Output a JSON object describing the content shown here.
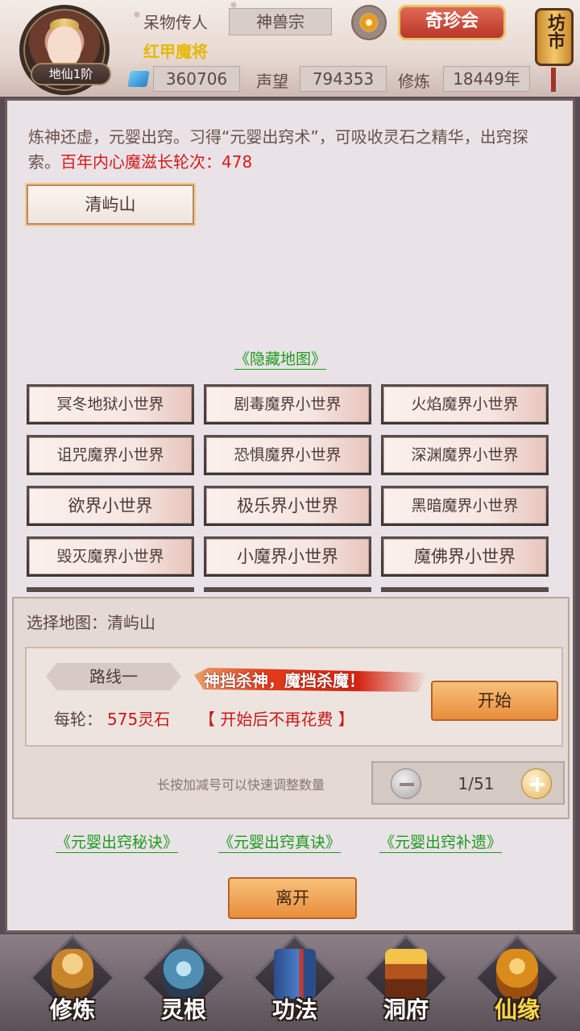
{
  "header": {
    "level_badge": "地仙1阶",
    "title_primary": "呆物传人",
    "sect": "神兽宗",
    "title_secondary": "红甲魔将",
    "treasure_button": "奇珍会",
    "market_label": "坊市",
    "gems": "360706",
    "reputation_label": "声望",
    "reputation": "794353",
    "cultivation_label": "修炼",
    "cultivation": "18449年"
  },
  "panel": {
    "description_main": "炼神还虚，元婴出窍。习得“元婴出窍术”，可吸收灵石之精华，出窍探索。",
    "description_highlight": "百年内心魔滋长轮次：478",
    "current_map": "清屿山",
    "hidden_map_link": "《隐藏地图》",
    "maps": [
      "冥冬地狱小世界",
      "剧毒魔界小世界",
      "火焰魔界小世界",
      "诅咒魔界小世界",
      "恐惧魔界小世界",
      "深渊魔界小世界",
      "欲界小世界",
      "极乐界小世界",
      "黑暗魔界小世界",
      "毁灭魔界小世界",
      "小魔界小世界",
      "魔佛界小世界"
    ],
    "select_label": "选择地图：清屿山",
    "route": {
      "name": "路线一",
      "slogan": "神挡杀神，魔挡杀魔！",
      "cost_label": "每轮：",
      "cost_value": "575灵石",
      "cost_note": "【 开始后不再花费 】",
      "start_button": "开始"
    },
    "quantity_hint": "长按加减号可以快速调整数量",
    "quantity": "1/51",
    "links": [
      "《元婴出窍秘诀》",
      "《元婴出窍真诀》",
      "《元婴出窍补遗》"
    ],
    "leave_button": "离开"
  },
  "nav": [
    {
      "label": "修炼",
      "icon": "cultivation-figure-icon",
      "active": false
    },
    {
      "label": "灵根",
      "icon": "spirit-root-icon",
      "active": false
    },
    {
      "label": "功法",
      "icon": "scripture-book-icon",
      "active": false
    },
    {
      "label": "洞府",
      "icon": "cave-dwelling-icon",
      "active": false
    },
    {
      "label": "仙缘",
      "icon": "gourd-icon",
      "active": true
    }
  ]
}
